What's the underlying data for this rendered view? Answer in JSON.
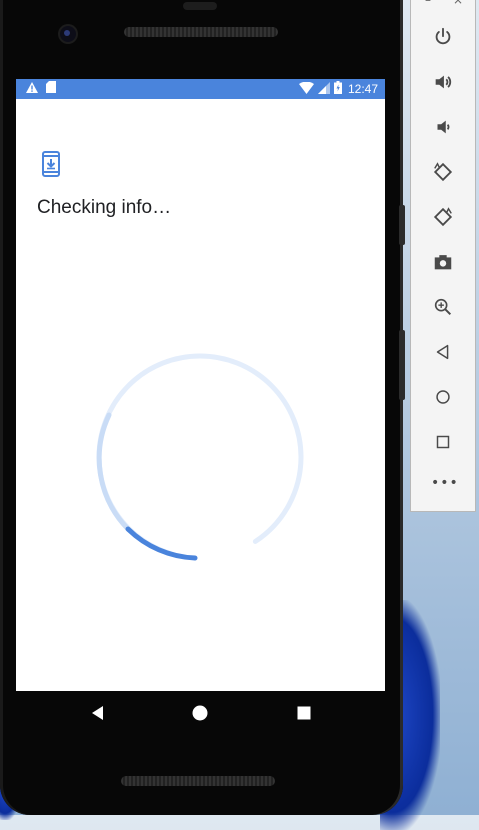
{
  "status_bar": {
    "time": "12:47",
    "left_icons": [
      "alert-icon",
      "sd-card-icon"
    ],
    "right_icons": [
      "wifi-icon",
      "signal-icon",
      "battery-icon"
    ],
    "background": "#4a84dc"
  },
  "screen": {
    "app_icon": "phone-download-icon",
    "title": "Checking info…",
    "spinner": {
      "track_color": "#e3edfb",
      "progress_color": "#4a84dc"
    }
  },
  "nav_bar": {
    "buttons": [
      "back-icon",
      "home-icon",
      "recents-icon"
    ]
  },
  "emulator_toolbar": {
    "window_controls": [
      "minimize-icon",
      "close-icon"
    ],
    "items": [
      {
        "name": "power-button",
        "icon": "power-icon"
      },
      {
        "name": "volume-up-button",
        "icon": "volume-up-icon"
      },
      {
        "name": "volume-down-button",
        "icon": "volume-down-icon"
      },
      {
        "name": "rotate-left-button",
        "icon": "rotate-left-icon"
      },
      {
        "name": "rotate-right-button",
        "icon": "rotate-right-icon"
      },
      {
        "name": "screenshot-button",
        "icon": "camera-icon"
      },
      {
        "name": "zoom-button",
        "icon": "zoom-in-icon"
      },
      {
        "name": "back-button",
        "icon": "back-icon"
      },
      {
        "name": "home-button",
        "icon": "home-icon"
      },
      {
        "name": "overview-button",
        "icon": "overview-icon"
      },
      {
        "name": "more-button",
        "icon": "more-icon"
      }
    ],
    "icon_color": "#4a4a4a"
  }
}
